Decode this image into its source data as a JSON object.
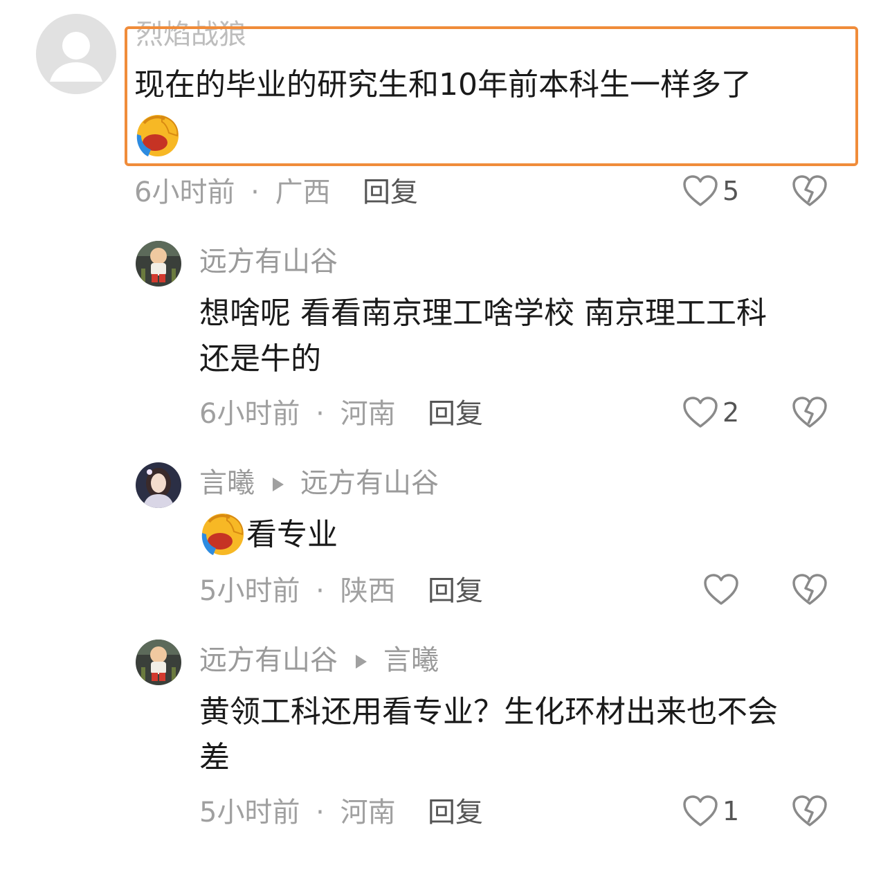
{
  "comments": [
    {
      "username": "烈焰战狼",
      "content": "现在的毕业的研究生和10年前本科生一样多了",
      "time": "6小时前",
      "location": "广西",
      "reply_label": "回复",
      "likes": "5"
    },
    {
      "username": "远方有山谷",
      "content_line1": "想啥呢 看看南京理工啥学校 南京理工工科",
      "content_line2": "还是牛的",
      "time": "6小时前",
      "location": "河南",
      "reply_label": "回复",
      "likes": "2"
    },
    {
      "username": "言曦",
      "reply_to": "远方有山谷",
      "content": "看专业",
      "time": "5小时前",
      "location": "陕西",
      "reply_label": "回复",
      "likes": ""
    },
    {
      "username": "远方有山谷",
      "reply_to": "言曦",
      "content_line1": "黄领工科还用看专业？生化环材出来也不会",
      "content_line2": "差",
      "time": "5小时前",
      "location": "河南",
      "reply_label": "回复",
      "likes": "1"
    }
  ],
  "separator": "·",
  "icons": {
    "like": "heart-outline-icon",
    "dislike": "broken-heart-icon",
    "emoji": "facepalm-laughing-emoji"
  },
  "colors": {
    "highlight_border": "#f08c3a",
    "username": "#9a9a9a",
    "content": "#1a1a1a",
    "meta": "#a0a0a0"
  }
}
